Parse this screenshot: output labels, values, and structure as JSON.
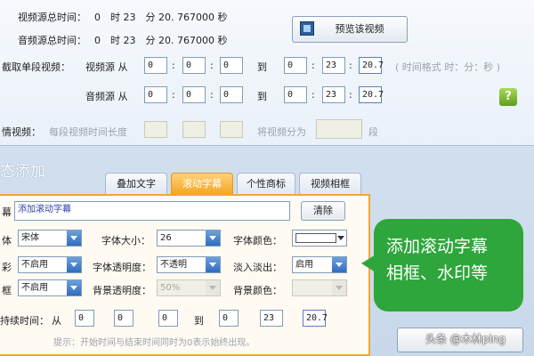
{
  "info": {
    "video_duration_label": "视频源总时间：",
    "video_duration_value": "0　时 23　分 20. 767000 秒",
    "audio_duration_label": "音频源总时间：",
    "audio_duration_value": "0　时 23　分 20. 767000 秒",
    "preview_button": "预览该视频"
  },
  "segment": {
    "label": "截取单段视频：",
    "video_label": "视频源 从",
    "audio_label": "音频源 从",
    "to": "到",
    "colon": ":",
    "video_from": [
      "0",
      "0",
      "0"
    ],
    "video_to": [
      "0",
      "23",
      "20.7"
    ],
    "audio_from": [
      "0",
      "0",
      "0"
    ],
    "audio_to": [
      "0",
      "23",
      "20.7"
    ],
    "format_hint": "( 时间格式 时：分：秒 )"
  },
  "split": {
    "label": "情视频：",
    "per_segment_label": "每段视频时间长度",
    "divide_label": "将视频分为",
    "unit": "段"
  },
  "section_title": "态添加",
  "tabs": [
    "叠加文字",
    "滚动字幕",
    "个性商标",
    "视频相框"
  ],
  "subtitle": {
    "text_label": "幕",
    "text_value": "添加滚动字幕",
    "clear_button": "清除",
    "font_label": "体",
    "font_value": "宋体",
    "size_label": "字体大小：",
    "size_value": "26",
    "color_label": "字体颜色：",
    "shadow_label": "彩",
    "shadow_value": "不启用",
    "opacity_label": "字体透明度：",
    "opacity_value": "不透明",
    "fade_label": "淡入淡出：",
    "fade_value": "启用",
    "border_label": "框",
    "border_value": "不启用",
    "bg_opacity_label": "背景透明度：",
    "bg_opacity_value": "50%",
    "bg_color_label": "背景颜色：",
    "duration_label": "持续时间：",
    "from": "从",
    "to": "到",
    "dur_from": [
      "0",
      "0",
      "0"
    ],
    "dur_to": [
      "0",
      "23",
      "20.7"
    ],
    "tip": "提示：开始时间与结束时间同时为0表示始终出现。"
  },
  "callout": [
    "添加滚动字幕",
    "相框、水印等"
  ],
  "watermark": "头条 @木林ping",
  "colors": {
    "accent_orange": "#f5a623",
    "callout_green": "#2ea63b"
  }
}
